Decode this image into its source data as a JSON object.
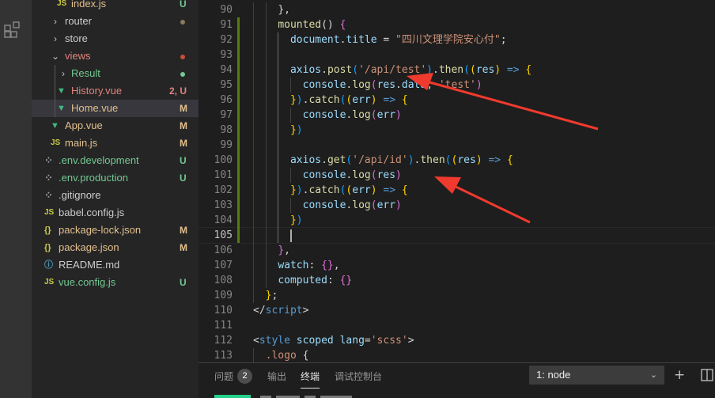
{
  "explorer": {
    "items": [
      {
        "name": "index.js",
        "kind": "js",
        "depth": 2,
        "color": "#e2c08d",
        "badge": "U",
        "badge_color": "#73c991",
        "chev": ""
      },
      {
        "name": "router",
        "kind": "folder",
        "depth": 1,
        "color": "#cccccc",
        "chev": "›",
        "dot": "#8a7a5a"
      },
      {
        "name": "store",
        "kind": "folder",
        "depth": 1,
        "color": "#cccccc",
        "chev": "›"
      },
      {
        "name": "views",
        "kind": "folder",
        "depth": 1,
        "color": "#e2837d",
        "chev": "⌄",
        "dot": "#c74e39"
      },
      {
        "name": "Result",
        "kind": "folder",
        "depth": 2,
        "color": "#73c991",
        "chev": "›",
        "dot": "#73c991"
      },
      {
        "name": "History.vue",
        "kind": "vue",
        "depth": 2,
        "color": "#e2837d",
        "badge": "2, U",
        "badge_color": "#e2837d"
      },
      {
        "name": "Home.vue",
        "kind": "vue",
        "depth": 2,
        "color": "#e2c08d",
        "badge": "M",
        "badge_color": "#e2c08d",
        "selected": true
      },
      {
        "name": "App.vue",
        "kind": "vue",
        "depth": 1,
        "color": "#e2c08d",
        "badge": "M",
        "badge_color": "#e2c08d"
      },
      {
        "name": "main.js",
        "kind": "js",
        "depth": 1,
        "color": "#e2c08d",
        "badge": "M",
        "badge_color": "#e2c08d"
      },
      {
        "name": ".env.development",
        "kind": "dot",
        "depth": 0,
        "color": "#73c991",
        "badge": "U",
        "badge_color": "#73c991"
      },
      {
        "name": ".env.production",
        "kind": "dot",
        "depth": 0,
        "color": "#73c991",
        "badge": "U",
        "badge_color": "#73c991"
      },
      {
        "name": ".gitignore",
        "kind": "dot",
        "depth": 0,
        "color": "#cccccc"
      },
      {
        "name": "babel.config.js",
        "kind": "js",
        "depth": 0,
        "color": "#cccccc"
      },
      {
        "name": "package-lock.json",
        "kind": "json",
        "depth": 0,
        "color": "#e2c08d",
        "badge": "M",
        "badge_color": "#e2c08d"
      },
      {
        "name": "package.json",
        "kind": "json",
        "depth": 0,
        "color": "#e2c08d",
        "badge": "M",
        "badge_color": "#e2c08d"
      },
      {
        "name": "README.md",
        "kind": "info",
        "depth": 0,
        "color": "#cccccc"
      },
      {
        "name": "vue.config.js",
        "kind": "js",
        "depth": 0,
        "color": "#73c991",
        "badge": "U",
        "badge_color": "#73c991"
      }
    ],
    "icon_glyphs": {
      "js": "JS",
      "vue": "▼",
      "json": "{}",
      "dot": "⁘",
      "info": "ⓘ"
    }
  },
  "editor": {
    "current_line": 105,
    "lines": [
      {
        "n": "90",
        "indent": 2,
        "tokens": [
          [
            "},",
            "t-p"
          ]
        ]
      },
      {
        "n": "91",
        "indent": 2,
        "tokens": [
          [
            "mounted",
            "t-fn"
          ],
          [
            "() ",
            "t-p"
          ],
          [
            "{",
            "t-b2"
          ]
        ]
      },
      {
        "n": "92",
        "indent": 3,
        "tokens": [
          [
            "document",
            "t-prop"
          ],
          [
            ".",
            "t-p"
          ],
          [
            "title",
            "t-prop"
          ],
          [
            " = ",
            "t-p"
          ],
          [
            "\"四川文理学院安心付\"",
            "t-str"
          ],
          [
            ";",
            "t-p"
          ]
        ]
      },
      {
        "n": "93",
        "indent": 0,
        "tokens": []
      },
      {
        "n": "94",
        "indent": 3,
        "tokens": [
          [
            "axios",
            "t-prop"
          ],
          [
            ".",
            "t-p"
          ],
          [
            "post",
            "t-fn"
          ],
          [
            "(",
            "t-b3"
          ],
          [
            "'/api/test'",
            "t-str"
          ],
          [
            ")",
            "t-b3"
          ],
          [
            ".",
            "t-p"
          ],
          [
            "then",
            "t-fn"
          ],
          [
            "(",
            "t-b3"
          ],
          [
            "(",
            "t-b1"
          ],
          [
            "res",
            "t-prop"
          ],
          [
            ")",
            "t-b1"
          ],
          [
            " => ",
            "t-kw"
          ],
          [
            "{",
            "t-b1"
          ]
        ]
      },
      {
        "n": "95",
        "indent": 4,
        "tokens": [
          [
            "console",
            "t-prop"
          ],
          [
            ".",
            "t-p"
          ],
          [
            "log",
            "t-fn"
          ],
          [
            "(",
            "t-b2"
          ],
          [
            "res",
            "t-prop"
          ],
          [
            ".",
            "t-p"
          ],
          [
            "data",
            "t-prop"
          ],
          [
            ", ",
            "t-p"
          ],
          [
            "'test'",
            "t-str"
          ],
          [
            ")",
            "t-b2"
          ]
        ]
      },
      {
        "n": "96",
        "indent": 3,
        "tokens": [
          [
            "}",
            "t-b1"
          ],
          [
            ")",
            "t-b3"
          ],
          [
            ".",
            "t-p"
          ],
          [
            "catch",
            "t-fn"
          ],
          [
            "(",
            "t-b3"
          ],
          [
            "(",
            "t-b1"
          ],
          [
            "err",
            "t-prop"
          ],
          [
            ")",
            "t-b1"
          ],
          [
            " => ",
            "t-kw"
          ],
          [
            "{",
            "t-b1"
          ]
        ]
      },
      {
        "n": "97",
        "indent": 4,
        "tokens": [
          [
            "console",
            "t-prop"
          ],
          [
            ".",
            "t-p"
          ],
          [
            "log",
            "t-fn"
          ],
          [
            "(",
            "t-b2"
          ],
          [
            "err",
            "t-prop"
          ],
          [
            ")",
            "t-b2"
          ]
        ]
      },
      {
        "n": "98",
        "indent": 3,
        "tokens": [
          [
            "}",
            "t-b1"
          ],
          [
            ")",
            "t-b3"
          ]
        ]
      },
      {
        "n": "99",
        "indent": 0,
        "tokens": []
      },
      {
        "n": "100",
        "indent": 3,
        "tokens": [
          [
            "axios",
            "t-prop"
          ],
          [
            ".",
            "t-p"
          ],
          [
            "get",
            "t-fn"
          ],
          [
            "(",
            "t-b3"
          ],
          [
            "'/api/id'",
            "t-str"
          ],
          [
            ")",
            "t-b3"
          ],
          [
            ".",
            "t-p"
          ],
          [
            "then",
            "t-fn"
          ],
          [
            "(",
            "t-b3"
          ],
          [
            "(",
            "t-b1"
          ],
          [
            "res",
            "t-prop"
          ],
          [
            ")",
            "t-b1"
          ],
          [
            " => ",
            "t-kw"
          ],
          [
            "{",
            "t-b1"
          ]
        ]
      },
      {
        "n": "101",
        "indent": 4,
        "tokens": [
          [
            "console",
            "t-prop"
          ],
          [
            ".",
            "t-p"
          ],
          [
            "log",
            "t-fn"
          ],
          [
            "(",
            "t-b2"
          ],
          [
            "res",
            "t-prop"
          ],
          [
            ")",
            "t-b2"
          ]
        ]
      },
      {
        "n": "102",
        "indent": 3,
        "tokens": [
          [
            "}",
            "t-b1"
          ],
          [
            ")",
            "t-b3"
          ],
          [
            ".",
            "t-p"
          ],
          [
            "catch",
            "t-fn"
          ],
          [
            "(",
            "t-b3"
          ],
          [
            "(",
            "t-b1"
          ],
          [
            "err",
            "t-prop"
          ],
          [
            ")",
            "t-b1"
          ],
          [
            " => ",
            "t-kw"
          ],
          [
            "{",
            "t-b1"
          ]
        ]
      },
      {
        "n": "103",
        "indent": 4,
        "tokens": [
          [
            "console",
            "t-prop"
          ],
          [
            ".",
            "t-p"
          ],
          [
            "log",
            "t-fn"
          ],
          [
            "(",
            "t-b2"
          ],
          [
            "err",
            "t-prop"
          ],
          [
            ")",
            "t-b2"
          ]
        ]
      },
      {
        "n": "104",
        "indent": 3,
        "tokens": [
          [
            "}",
            "t-b1"
          ],
          [
            ")",
            "t-b3"
          ]
        ]
      },
      {
        "n": "105",
        "indent": 3,
        "tokens": []
      },
      {
        "n": "106",
        "indent": 2,
        "tokens": [
          [
            "}",
            "t-b2"
          ],
          [
            ",",
            "t-p"
          ]
        ]
      },
      {
        "n": "107",
        "indent": 2,
        "tokens": [
          [
            "watch",
            "t-prop"
          ],
          [
            ": ",
            "t-p"
          ],
          [
            "{}",
            "t-b2"
          ],
          [
            ",",
            "t-p"
          ]
        ]
      },
      {
        "n": "108",
        "indent": 2,
        "tokens": [
          [
            "computed",
            "t-prop"
          ],
          [
            ": ",
            "t-p"
          ],
          [
            "{}",
            "t-b2"
          ]
        ]
      },
      {
        "n": "109",
        "indent": 1,
        "tokens": [
          [
            "}",
            "t-b1"
          ],
          [
            ";",
            "t-p"
          ]
        ]
      },
      {
        "n": "110",
        "indent": 0,
        "tokens": [
          [
            "</",
            "t-p"
          ],
          [
            "script",
            "t-tag"
          ],
          [
            ">",
            "t-p"
          ]
        ]
      },
      {
        "n": "111",
        "indent": 0,
        "tokens": []
      },
      {
        "n": "112",
        "indent": 0,
        "tokens": [
          [
            "<",
            "t-p"
          ],
          [
            "style",
            "t-tag"
          ],
          [
            " ",
            "t-p"
          ],
          [
            "scoped",
            "t-prop"
          ],
          [
            " ",
            "t-p"
          ],
          [
            "lang",
            "t-prop"
          ],
          [
            "=",
            "t-p"
          ],
          [
            "'scss'",
            "t-str"
          ],
          [
            ">",
            "t-p"
          ]
        ]
      },
      {
        "n": "113",
        "indent": 1,
        "tokens": [
          [
            ".logo",
            "t-str"
          ],
          [
            " {",
            "t-p"
          ]
        ]
      }
    ]
  },
  "panel": {
    "tabs": [
      "问题",
      "输出",
      "终端",
      "调试控制台"
    ],
    "active_tab": "终端",
    "problems_count": "2",
    "terminal_select": "1: node",
    "actions": [
      "new-terminal",
      "split-terminal"
    ]
  },
  "annotations": {
    "arrow_color": "#f03a2e",
    "count": 2
  }
}
